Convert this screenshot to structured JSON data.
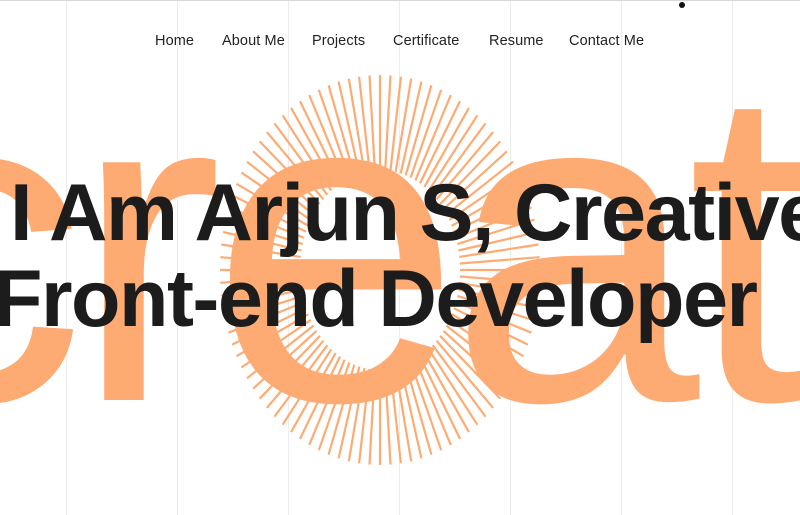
{
  "nav": {
    "items": [
      {
        "label": "Home"
      },
      {
        "label": "About Me"
      },
      {
        "label": "Projects"
      },
      {
        "label": "Certificate"
      },
      {
        "label": "Resume"
      },
      {
        "label": "Contact Me"
      }
    ]
  },
  "hero": {
    "background_word": "creative",
    "headline_line1": "I Am Arjun S, Creative",
    "headline_line2": "Front-end Developer"
  },
  "colors": {
    "accent": "#fdab73",
    "text": "#1c1c1c",
    "background": "#ffffff",
    "grid": "#ececec"
  }
}
